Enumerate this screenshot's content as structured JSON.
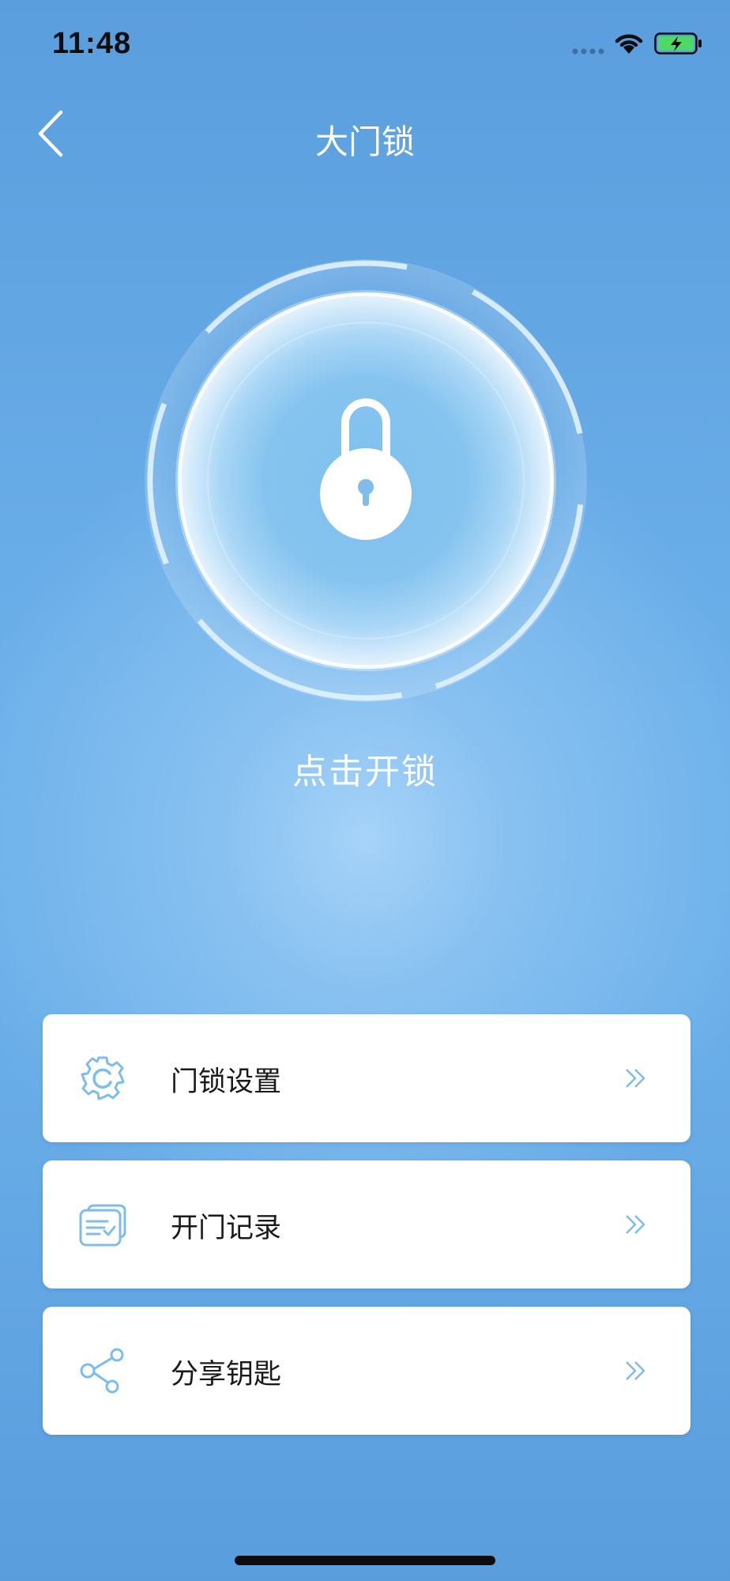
{
  "status_bar": {
    "time": "11:48",
    "icons": [
      "cellular-signal-icon",
      "wifi-icon",
      "battery-charging-icon"
    ]
  },
  "nav": {
    "back_icon": "chevron-left-icon",
    "title": "大门锁"
  },
  "lock": {
    "icon": "padlock-icon",
    "action_label": "点击开锁"
  },
  "menu": {
    "items": [
      {
        "label": "门锁设置",
        "icon": "gear-icon"
      },
      {
        "label": "开门记录",
        "icon": "records-list-icon"
      },
      {
        "label": "分享钥匙",
        "icon": "share-icon"
      }
    ],
    "chevron_icon": "double-chevron-right-icon"
  },
  "colors": {
    "background_top": "#5b9ede",
    "background_glow": "#a6d3f8",
    "accent": "#7dbcec",
    "card": "#ffffff",
    "text_dark": "#1a1a1a",
    "text_light": "#ffffff",
    "battery_fill": "#4cd964"
  }
}
